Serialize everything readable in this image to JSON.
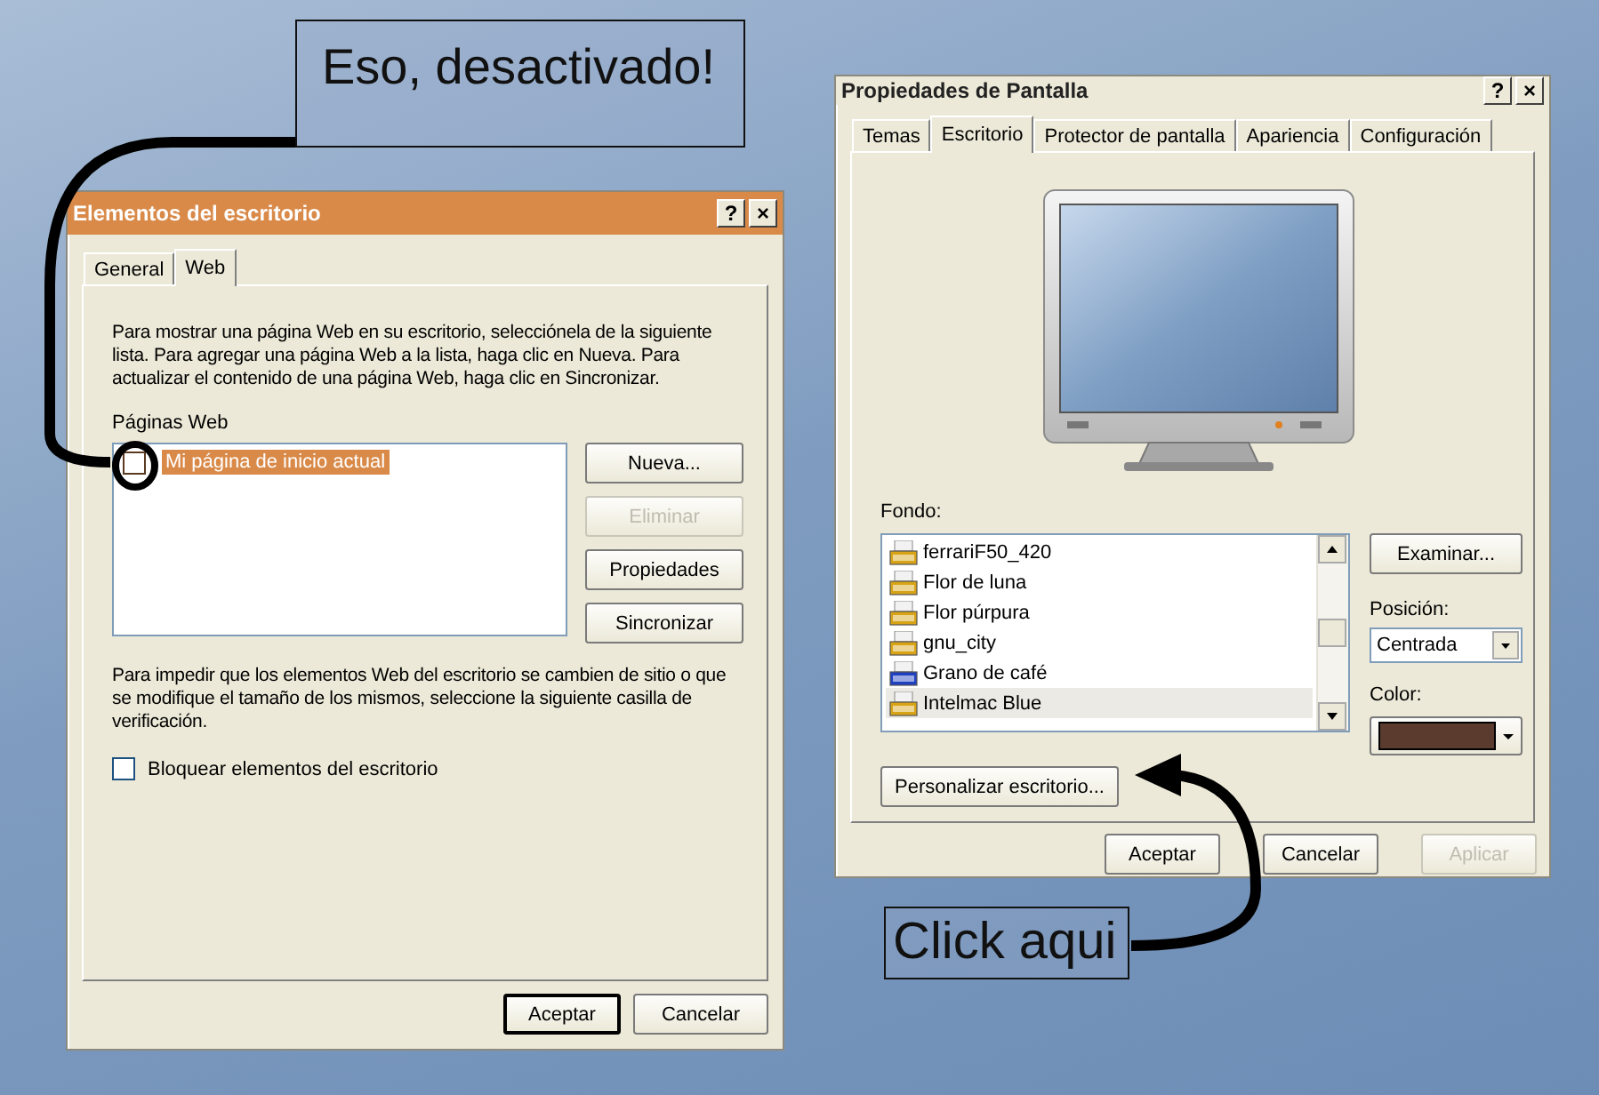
{
  "annotations": [
    {
      "text": "Eso, desactivado!"
    },
    {
      "text": "Click aqui"
    }
  ],
  "desktop_items_dialog": {
    "title": "Elementos del escritorio",
    "title_buttons": [
      "?",
      "×"
    ],
    "tabs": [
      {
        "label": "General",
        "selected": false
      },
      {
        "label": "Web",
        "selected": true
      }
    ],
    "description": "Para mostrar una página Web en su escritorio, selecciónela de la siguiente lista. Para agregar una página Web a la lista, haga clic en Nueva. Para actualizar el contenido de una página Web, haga clic en Sincronizar.",
    "list_label": "Páginas Web",
    "pages": [
      {
        "label": "Mi página de inicio actual",
        "checked": false,
        "selected": true
      }
    ],
    "side_buttons": [
      {
        "label": "Nueva...",
        "disabled": false
      },
      {
        "label": "Eliminar",
        "disabled": true
      },
      {
        "label": "Propiedades",
        "disabled": false
      },
      {
        "label": "Sincronizar",
        "disabled": false
      }
    ],
    "lock_description": "Para impedir que los elementos Web del escritorio se cambien de sitio o que se modifique el tamaño de los mismos, seleccione la siguiente casilla de verificación.",
    "lock_checkbox": {
      "label": "Bloquear elementos del escritorio",
      "checked": false
    },
    "footer_buttons": [
      {
        "label": "Aceptar",
        "default": true,
        "disabled": false
      },
      {
        "label": "Cancelar",
        "default": false,
        "disabled": false
      }
    ]
  },
  "display_dialog": {
    "title": "Propiedades de Pantalla",
    "title_buttons": [
      "?",
      "×"
    ],
    "tabs": [
      {
        "label": "Temas",
        "selected": false
      },
      {
        "label": "Escritorio",
        "selected": true
      },
      {
        "label": "Protector de pantalla",
        "selected": false
      },
      {
        "label": "Apariencia",
        "selected": false
      },
      {
        "label": "Configuración",
        "selected": false
      }
    ],
    "background_label": "Fondo:",
    "backgrounds": [
      {
        "label": "ferrariF50_420",
        "kind": "jpg",
        "selected": false
      },
      {
        "label": "Flor de luna",
        "kind": "jpg",
        "selected": false
      },
      {
        "label": "Flor púrpura",
        "kind": "jpg",
        "selected": false
      },
      {
        "label": "gnu_city",
        "kind": "jpg",
        "selected": false
      },
      {
        "label": "Grano de café",
        "kind": "bmp",
        "selected": false
      },
      {
        "label": "Intelmac Blue",
        "kind": "jpg",
        "selected": true
      }
    ],
    "browse_button": "Examinar...",
    "position_label": "Posición:",
    "position_value": "Centrada",
    "color_label": "Color:",
    "color": "#5b3b2d",
    "customize_button": "Personalizar escritorio...",
    "footer_buttons": [
      {
        "label": "Aceptar",
        "default": false,
        "disabled": false
      },
      {
        "label": "Cancelar",
        "default": false,
        "disabled": false
      },
      {
        "label": "Aplicar",
        "default": false,
        "disabled": true
      }
    ]
  }
}
